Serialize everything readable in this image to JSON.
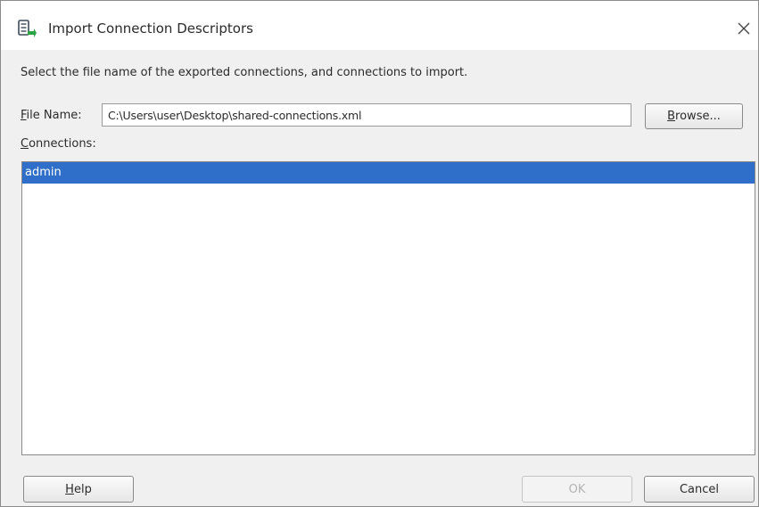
{
  "window": {
    "title": "Import Connection Descriptors",
    "icon": "database-import-icon",
    "close_glyph": "✕"
  },
  "instructions": "Select the file name of the exported connections, and connections to import.",
  "file_name": {
    "label_mnemonic": "F",
    "label_rest": "ile Name:",
    "value": "C:\\Users\\user\\Desktop\\shared-connections.xml"
  },
  "browse": {
    "label_mnemonic": "B",
    "label_rest": "rowse..."
  },
  "connections": {
    "label_mnemonic": "C",
    "label_rest": "onnections:",
    "items": [
      {
        "label": "admin",
        "selected": true
      }
    ]
  },
  "buttons": {
    "help_mnemonic": "H",
    "help_rest": "elp",
    "ok": "OK",
    "cancel": "Cancel"
  },
  "colors": {
    "selection": "#2f6fc9",
    "icon_accent": "#2aa345"
  }
}
